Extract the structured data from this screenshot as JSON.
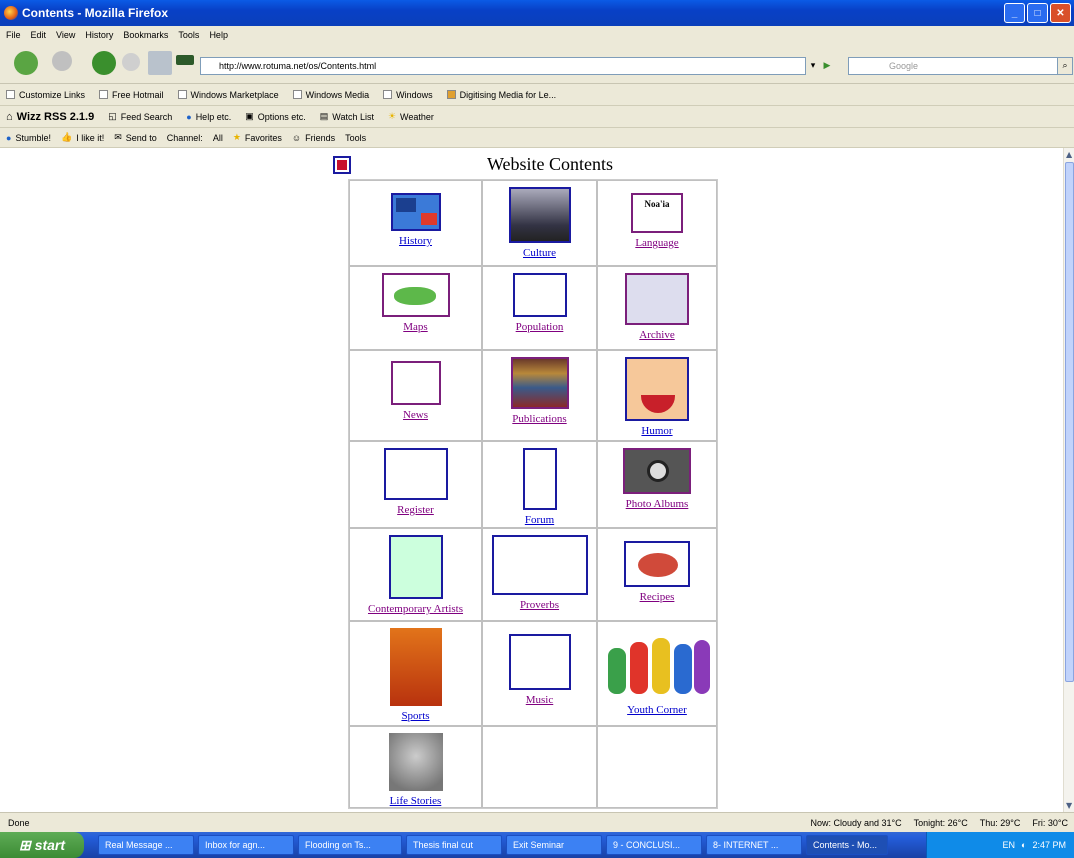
{
  "window": {
    "title": "Contents - Mozilla Firefox"
  },
  "menu": [
    "File",
    "Edit",
    "View",
    "History",
    "Bookmarks",
    "Tools",
    "Help"
  ],
  "address": {
    "url": "http://www.rotuma.net/os/Contents.html"
  },
  "search": {
    "placeholder": "Google"
  },
  "bookmarks": [
    "Customize Links",
    "Free Hotmail",
    "Windows Marketplace",
    "Windows Media",
    "Windows",
    "Digitising Media for Le..."
  ],
  "wizz_toolbar": {
    "title": "Wizz RSS 2.1.9",
    "items": [
      "Feed Search",
      "Help etc.",
      "Options etc.",
      "Watch List",
      "Weather"
    ]
  },
  "stumble_toolbar": {
    "items": [
      "Stumble!",
      "I like it!",
      "Send to",
      "Channel:",
      "All",
      "Favorites",
      "Friends",
      "Tools"
    ]
  },
  "page": {
    "title": "Website Contents",
    "cells": [
      {
        "label": "History",
        "visited": false,
        "icon": "flags-icon"
      },
      {
        "label": "Culture",
        "visited": false,
        "icon": "culture-photo-icon"
      },
      {
        "label": "Language",
        "visited": true,
        "icon": "speech-bubble-icon",
        "icon_text": "Noa'ia"
      },
      {
        "label": "Maps",
        "visited": true,
        "icon": "map-icon"
      },
      {
        "label": "Population",
        "visited": true,
        "icon": "people-icon"
      },
      {
        "label": "Archive",
        "visited": true,
        "icon": "archive-building-icon"
      },
      {
        "label": "News",
        "visited": true,
        "icon": "news-icon"
      },
      {
        "label": "Publications",
        "visited": true,
        "icon": "books-icon"
      },
      {
        "label": "Humor",
        "visited": false,
        "icon": "laughing-face-icon"
      },
      {
        "label": "Register",
        "visited": true,
        "icon": "register-book-icon"
      },
      {
        "label": "Forum",
        "visited": false,
        "icon": "forum-door-icon"
      },
      {
        "label": "Photo Albums",
        "visited": true,
        "icon": "camera-icon"
      },
      {
        "label": "Contemporary Artists",
        "visited": true,
        "icon": "artist-icon"
      },
      {
        "label": "Proverbs",
        "visited": true,
        "icon": "proverbs-drawing-icon"
      },
      {
        "label": "Recipes",
        "visited": true,
        "icon": "food-icon"
      },
      {
        "label": "Sports",
        "visited": false,
        "icon": "runner-icon"
      },
      {
        "label": "Music",
        "visited": true,
        "icon": "music-icon"
      },
      {
        "label": "Youth Corner",
        "visited": false,
        "icon": "kids-icon"
      },
      {
        "label": "Life Stories",
        "visited": false,
        "icon": "portrait-icon"
      }
    ]
  },
  "status": {
    "text": "Done",
    "weather_now": "Now: Cloudy and 31°C",
    "tonight": "Tonight: 26°C",
    "thu": "Thu: 29°C",
    "fri": "Fri: 30°C"
  },
  "taskbar": {
    "start": "start",
    "buttons": [
      "Real Message ...",
      "Inbox for agn...",
      "Flooding on Ts...",
      "Thesis final cut",
      "Exit Seminar",
      "9 - CONCLUSI...",
      "8- INTERNET ...",
      "Contents - Mo..."
    ],
    "lang": "EN",
    "clock": "2:47 PM"
  }
}
